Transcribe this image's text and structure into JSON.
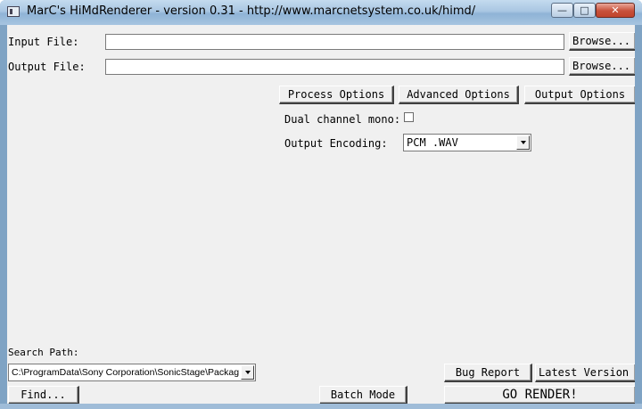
{
  "window": {
    "title": "MarC's HiMdRenderer - version 0.31 - http://www.marcnetsystem.co.uk/himd/",
    "minimize_label": "—",
    "maximize_label": "□",
    "close_label": "✕"
  },
  "input_file": {
    "label": "Input File:",
    "value": "",
    "browse_label": "Browse..."
  },
  "output_file": {
    "label": "Output File:",
    "value": "",
    "browse_label": "Browse..."
  },
  "tabs": {
    "process": "Process Options",
    "advanced": "Advanced Options",
    "output": "Output Options"
  },
  "output_options": {
    "dual_channel_label": "Dual channel mono:",
    "dual_channel_checked": false,
    "encoding_label": "Output Encoding:",
    "encoding_value": "PCM .WAV"
  },
  "search": {
    "label": "Search Path:",
    "value": "C:\\ProgramData\\Sony Corporation\\SonicStage\\Packag"
  },
  "buttons": {
    "find": "Find...",
    "batch_mode": "Batch Mode",
    "bug_report": "Bug Report",
    "latest_version": "Latest Version",
    "go_render": "GO RENDER!"
  }
}
